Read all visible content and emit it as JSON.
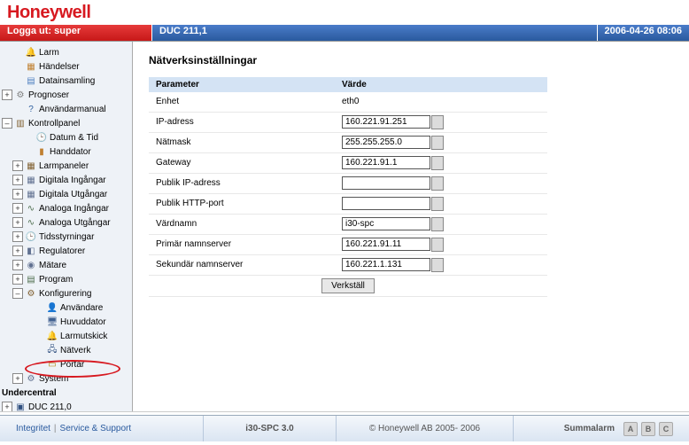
{
  "brand": "Honeywell",
  "header": {
    "logout": "Logga ut: super",
    "title": "DUC 211,1",
    "timestamp": "2006-04-26 08:06"
  },
  "tree": {
    "larm": "Larm",
    "handelser": "Händelser",
    "datainsamling": "Datainsamling",
    "prognoser": "Prognoser",
    "anvandarmanual": "Användarmanual",
    "kontrollpanel": "Kontrollpanel",
    "datum_tid": "Datum & Tid",
    "handdator": "Handdator",
    "larmpaneler": "Larmpaneler",
    "dig_in": "Digitala Ingångar",
    "dig_ut": "Digitala Utgångar",
    "ana_in": "Analoga Ingångar",
    "ana_ut": "Analoga Utgångar",
    "tidsstyrningar": "Tidsstyrningar",
    "regulatorer": "Regulatorer",
    "matare": "Mätare",
    "program": "Program",
    "konfigurering": "Konfigurering",
    "anvandare": "Användare",
    "huvuddator": "Huvuddator",
    "larmutskick": "Larmutskick",
    "natverk": "Nätverk",
    "portar": "Portar",
    "system": "System",
    "undercentral": "Undercentral",
    "duc": "DUC 211,0"
  },
  "page": {
    "title": "Nätverksinställningar",
    "headers": {
      "param": "Parameter",
      "value": "Värde"
    },
    "rows": {
      "enhet": {
        "label": "Enhet",
        "value": "eth0"
      },
      "ip": {
        "label": "IP-adress",
        "value": "160.221.91.251"
      },
      "natmask": {
        "label": "Nätmask",
        "value": "255.255.255.0"
      },
      "gateway": {
        "label": "Gateway",
        "value": "160.221.91.1"
      },
      "publik_ip": {
        "label": "Publik IP-adress",
        "value": ""
      },
      "publik_http": {
        "label": "Publik HTTP-port",
        "value": ""
      },
      "vardnamn": {
        "label": "Värdnamn",
        "value": "i30-spc"
      },
      "primar": {
        "label": "Primär namnserver",
        "value": "160.221.91.11"
      },
      "sekundar": {
        "label": "Sekundär namnserver",
        "value": "160.221.1.131"
      }
    },
    "submit": "Verkställ"
  },
  "footer": {
    "integritet": "Integritet",
    "support": "Service & Support",
    "product": "i30-SPC 3.0",
    "copyright": "© Honeywell AB 2005- 2006",
    "summalarm": "Summalarm",
    "badges": {
      "a": "A",
      "b": "B",
      "c": "C"
    }
  }
}
